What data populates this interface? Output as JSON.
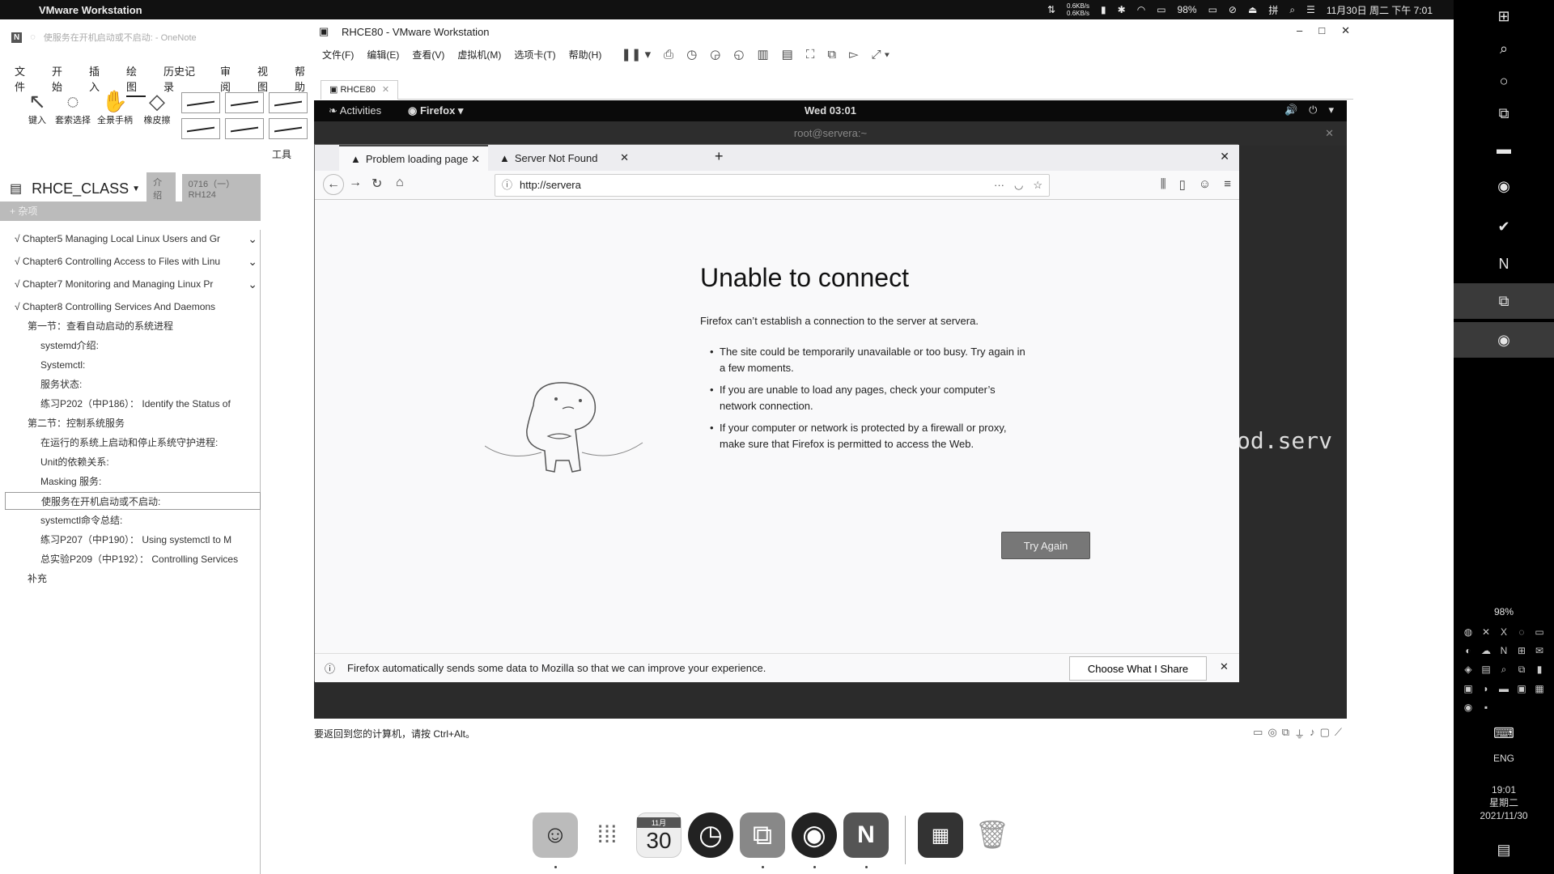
{
  "mac_menubar": {
    "app_name": "VMware Workstation",
    "net_up": "0.6KB/s",
    "net_down": "0.6KB/s",
    "battery": "98%",
    "datetime": "11月30日 周二 下午 7:01"
  },
  "onenote": {
    "title_text": "使服务在开机启动或不启动:  - OneNote",
    "ribbon_tabs": [
      "文件",
      "开始",
      "插入",
      "绘图",
      "历史记录",
      "审阅",
      "视图",
      "帮助"
    ],
    "active_tab": "绘图",
    "tools": [
      "键入",
      "套索选择",
      "全景手柄",
      "橡皮擦"
    ],
    "tools_group_label": "工具",
    "notebook_name": "RHCE_CLASS",
    "section_tabs": [
      "介绍",
      "0716（一）RH124"
    ],
    "section_header": "杂项",
    "pages": [
      "√ Chapter5 Managing Local Linux Users and Gr",
      "√ Chapter6 Controlling Access to Files with Linu",
      "√ Chapter7 Monitoring and Managing Linux Pr",
      "√ Chapter8 Controlling Services And Daemons",
      "第一节：查看自动启动的系统进程",
      "systemd介绍:",
      "Systemctl:",
      "服务状态:",
      "练习P202（中P186）： Identify the Status of",
      "第二节：控制系统服务",
      "在运行的系统上启动和停止系统守护进程:",
      "Unit的依赖关系:",
      "Masking 服务:",
      "使服务在开机启动或不启动:",
      "systemctl命令总结:",
      "练习P207（中P190）： Using systemctl to M",
      "总实验P209（中P192）： Controlling Services",
      "补充"
    ]
  },
  "vmware": {
    "window_title": "RHCE80 - VMware Workstation",
    "menus": [
      "文件(F)",
      "编辑(E)",
      "查看(V)",
      "虚拟机(M)",
      "选项卡(T)",
      "帮助(H)"
    ],
    "vm_tab": "RHCE80",
    "status_text": "要返回到您的计算机，请按 Ctrl+Alt。"
  },
  "gnome": {
    "activities": "Activities",
    "app_menu": "Firefox",
    "clock": "Wed 03:01",
    "terminal_title": "root@servera:~",
    "terminal_visible_text": "od.serv"
  },
  "firefox": {
    "tabs": [
      {
        "title": "Problem loading page",
        "active": true
      },
      {
        "title": "Server Not Found",
        "active": false
      }
    ],
    "url": "http://servera",
    "error_title": "Unable to connect",
    "error_subtitle": "Firefox can’t establish a connection to the server at servera.",
    "bullets": [
      "The site could be temporarily unavailable or too busy. Try again in a few moments.",
      "If you are unable to load any pages, check your computer’s network connection.",
      "If your computer or network is protected by a firewall or proxy, make sure that Firefox is permitted to access the Web."
    ],
    "try_again": "Try Again",
    "notice_text": "Firefox automatically sends some data to Mozilla so that we can improve your experience.",
    "choose_button": "Choose What I Share"
  },
  "dock": {
    "calendar_month": "11月",
    "calendar_day": "30"
  },
  "win_taskbar": {
    "battery": "98%",
    "lang": "ENG",
    "time": "19:01",
    "weekday": "星期二",
    "date": "2021/11/30"
  },
  "colors": {
    "guest_bg": "#2b2b2b",
    "firefox_bg": "#f9f9fa",
    "try_btn": "#777777"
  }
}
